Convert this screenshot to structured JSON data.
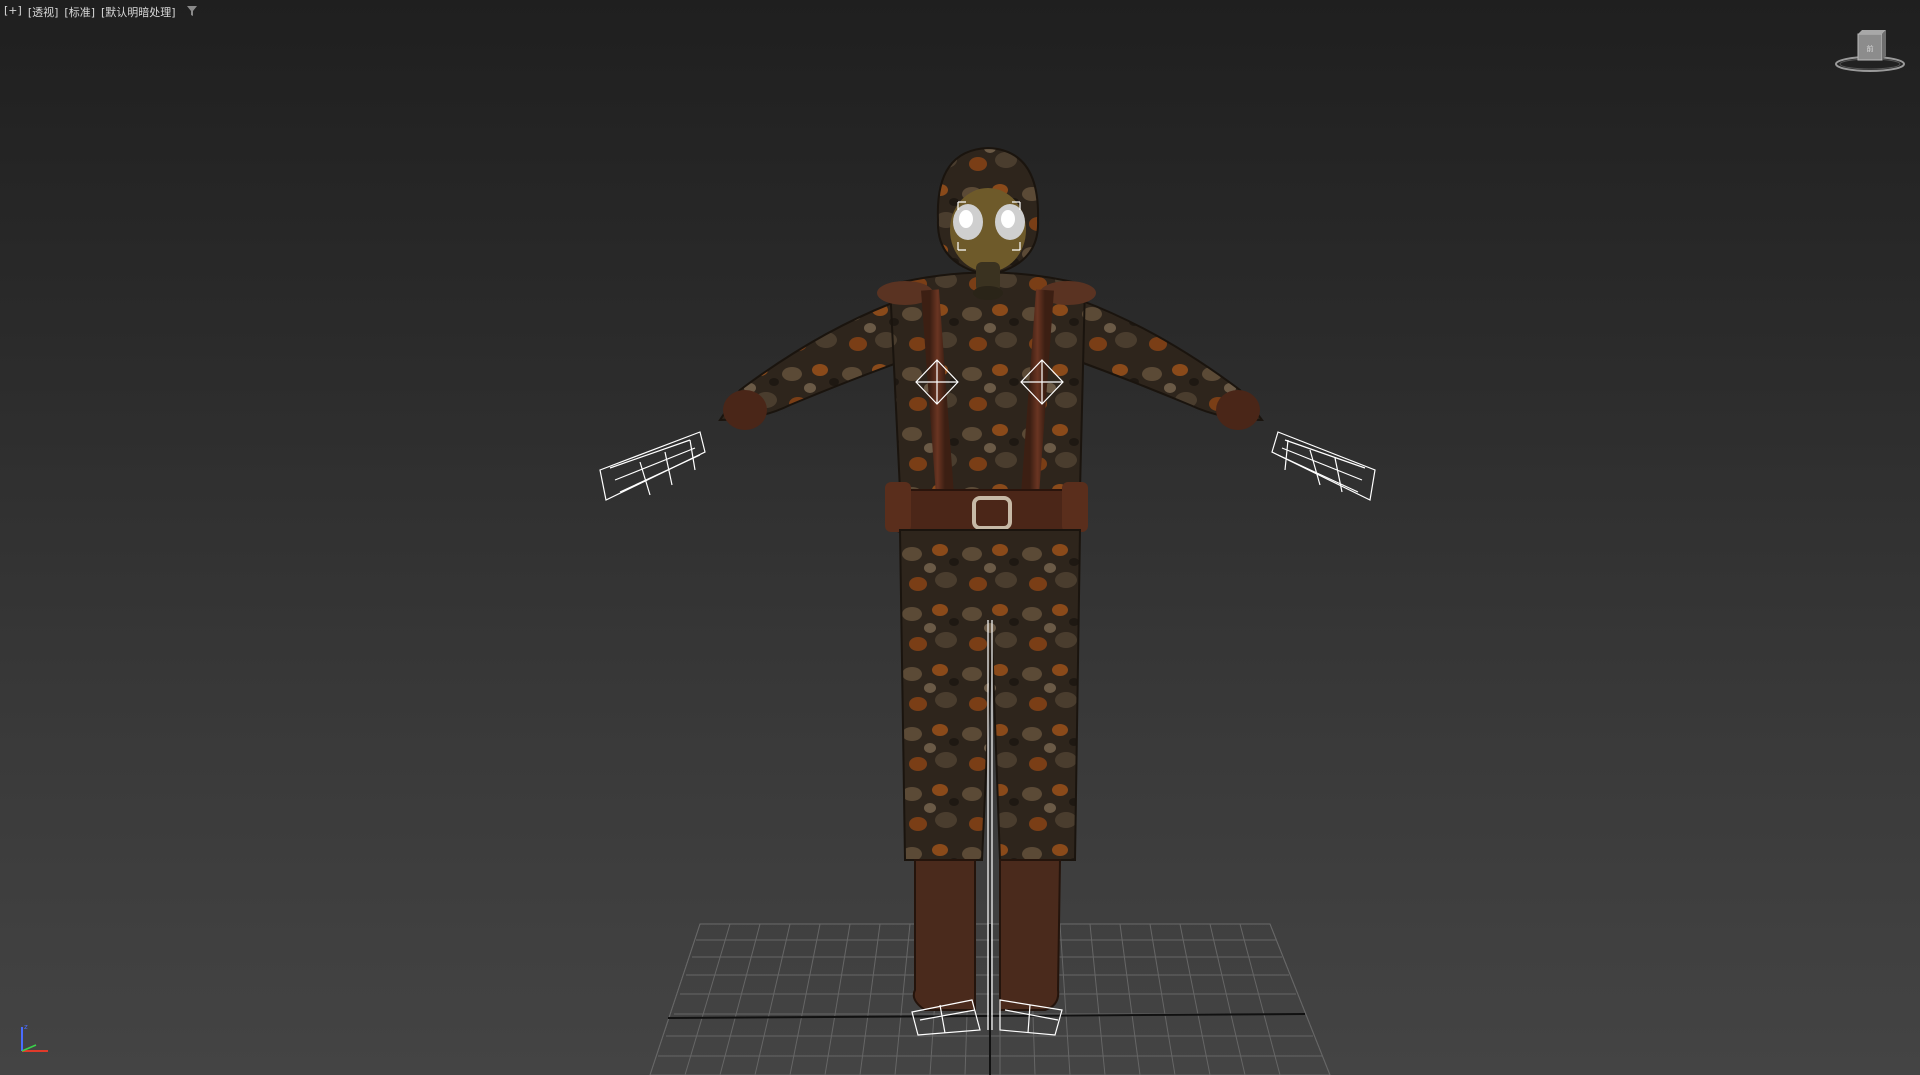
{
  "viewport": {
    "labels": [
      "[+]",
      "[透视]",
      "[标准]",
      "[默认明暗处理]"
    ],
    "filter_icon": "filter-icon",
    "viewcube_icon": "viewcube-icon",
    "axis_icon": "axis-tripod-icon"
  },
  "colors": {
    "bg_top": "#1f1f1f",
    "bg_bottom": "#444444",
    "grid": "#6a6a6a",
    "grid_axis": "#111111",
    "bone_wire": "#ffffff",
    "suit_base": "#3a2e22",
    "strap": "#5a2e1c"
  },
  "scene": {
    "object": "character-model",
    "description_visible": false
  }
}
